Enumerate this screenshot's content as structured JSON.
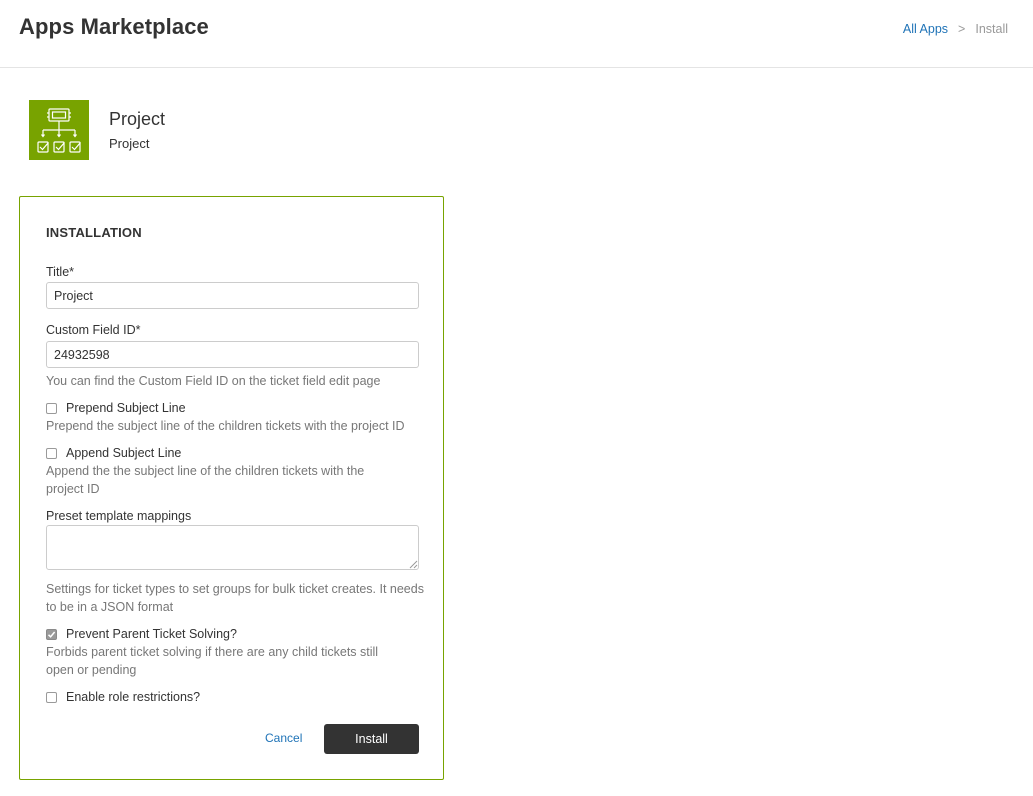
{
  "header": {
    "title": "Apps Marketplace",
    "breadcrumb": {
      "link": "All Apps",
      "separator": ">",
      "current": "Install"
    }
  },
  "app": {
    "icon": "project-hierarchy-icon",
    "icon_bg": "#78a300",
    "name": "Project",
    "subtitle": "Project"
  },
  "form": {
    "heading": "INSTALLATION",
    "title_field": {
      "label": "Title*",
      "value": "Project"
    },
    "custom_field_id": {
      "label": "Custom Field ID*",
      "value": "24932598",
      "hint": "You can find the Custom Field ID on the ticket field edit page"
    },
    "prepend_subject": {
      "label": "Prepend Subject Line",
      "checked": false,
      "hint": "Prepend the subject line of the children tickets with the project ID"
    },
    "append_subject": {
      "label": "Append Subject Line",
      "checked": false,
      "hint": "Append the the subject line of the children tickets with the project ID"
    },
    "preset_mappings": {
      "label": "Preset template mappings",
      "value": "",
      "hint": "Settings for ticket types to set groups for bulk ticket creates. It needs to be in a JSON format"
    },
    "prevent_parent_solving": {
      "label": "Prevent Parent Ticket Solving?",
      "checked": true,
      "hint": "Forbids parent ticket solving if there are any child tickets still open or pending"
    },
    "role_restrictions": {
      "label": "Enable role restrictions?",
      "checked": false
    },
    "cancel_label": "Cancel",
    "install_label": "Install"
  },
  "colors": {
    "accent_green": "#78a300",
    "link_blue": "#1f73b7",
    "button_dark": "#333333"
  }
}
